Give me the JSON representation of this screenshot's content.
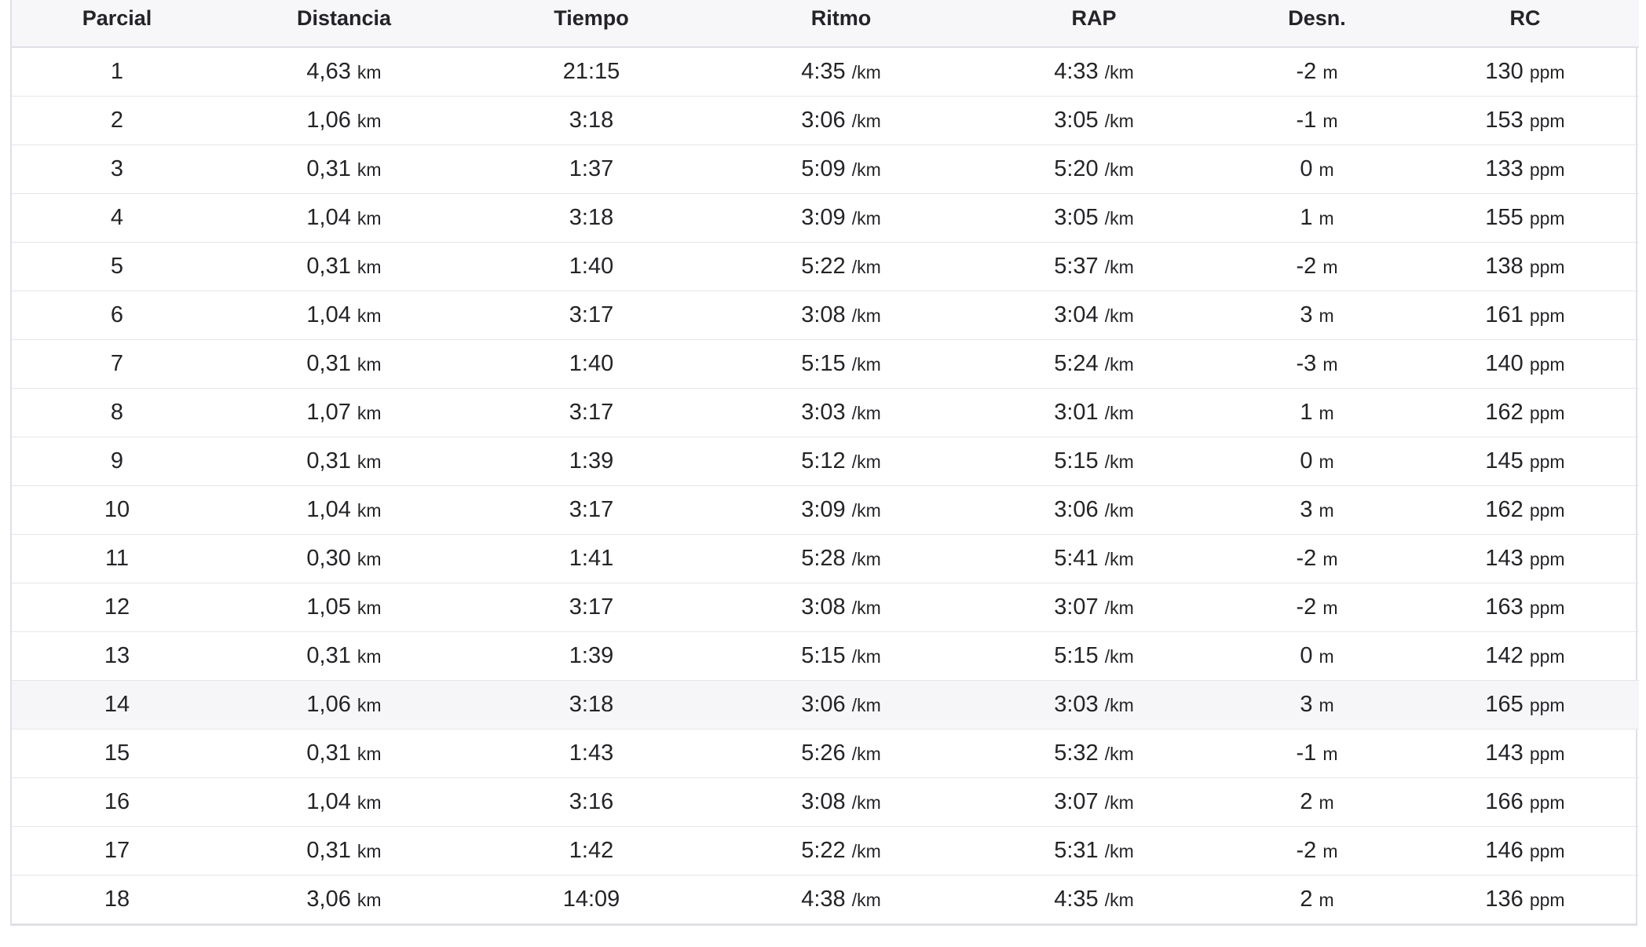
{
  "table": {
    "headers": [
      "Parcial",
      "Distancia",
      "Tiempo",
      "Ritmo",
      "RAP",
      "Desn.",
      "RC"
    ],
    "units": {
      "distance": "km",
      "pace": "/km",
      "gap": "/km",
      "elevation": "m",
      "heart_rate": "ppm"
    },
    "highlighted_row": "14",
    "rows": [
      {
        "split": "1",
        "distance": "4,63",
        "time": "21:15",
        "pace": "4:35",
        "gap": "4:33",
        "elev": "-2",
        "hr": "130"
      },
      {
        "split": "2",
        "distance": "1,06",
        "time": "3:18",
        "pace": "3:06",
        "gap": "3:05",
        "elev": "-1",
        "hr": "153"
      },
      {
        "split": "3",
        "distance": "0,31",
        "time": "1:37",
        "pace": "5:09",
        "gap": "5:20",
        "elev": "0",
        "hr": "133"
      },
      {
        "split": "4",
        "distance": "1,04",
        "time": "3:18",
        "pace": "3:09",
        "gap": "3:05",
        "elev": "1",
        "hr": "155"
      },
      {
        "split": "5",
        "distance": "0,31",
        "time": "1:40",
        "pace": "5:22",
        "gap": "5:37",
        "elev": "-2",
        "hr": "138"
      },
      {
        "split": "6",
        "distance": "1,04",
        "time": "3:17",
        "pace": "3:08",
        "gap": "3:04",
        "elev": "3",
        "hr": "161"
      },
      {
        "split": "7",
        "distance": "0,31",
        "time": "1:40",
        "pace": "5:15",
        "gap": "5:24",
        "elev": "-3",
        "hr": "140"
      },
      {
        "split": "8",
        "distance": "1,07",
        "time": "3:17",
        "pace": "3:03",
        "gap": "3:01",
        "elev": "1",
        "hr": "162"
      },
      {
        "split": "9",
        "distance": "0,31",
        "time": "1:39",
        "pace": "5:12",
        "gap": "5:15",
        "elev": "0",
        "hr": "145"
      },
      {
        "split": "10",
        "distance": "1,04",
        "time": "3:17",
        "pace": "3:09",
        "gap": "3:06",
        "elev": "3",
        "hr": "162"
      },
      {
        "split": "11",
        "distance": "0,30",
        "time": "1:41",
        "pace": "5:28",
        "gap": "5:41",
        "elev": "-2",
        "hr": "143"
      },
      {
        "split": "12",
        "distance": "1,05",
        "time": "3:17",
        "pace": "3:08",
        "gap": "3:07",
        "elev": "-2",
        "hr": "163"
      },
      {
        "split": "13",
        "distance": "0,31",
        "time": "1:39",
        "pace": "5:15",
        "gap": "5:15",
        "elev": "0",
        "hr": "142"
      },
      {
        "split": "14",
        "distance": "1,06",
        "time": "3:18",
        "pace": "3:06",
        "gap": "3:03",
        "elev": "3",
        "hr": "165"
      },
      {
        "split": "15",
        "distance": "0,31",
        "time": "1:43",
        "pace": "5:26",
        "gap": "5:32",
        "elev": "-1",
        "hr": "143"
      },
      {
        "split": "16",
        "distance": "1,04",
        "time": "3:16",
        "pace": "3:08",
        "gap": "3:07",
        "elev": "2",
        "hr": "166"
      },
      {
        "split": "17",
        "distance": "0,31",
        "time": "1:42",
        "pace": "5:22",
        "gap": "5:31",
        "elev": "-2",
        "hr": "146"
      },
      {
        "split": "18",
        "distance": "3,06",
        "time": "14:09",
        "pace": "4:38",
        "gap": "4:35",
        "elev": "2",
        "hr": "136"
      }
    ]
  },
  "colors": {
    "header_bg": "#f7f7fa",
    "row_highlight_bg": "#f6f6f8",
    "border": "#dfdfe8",
    "text": "#242428"
  }
}
